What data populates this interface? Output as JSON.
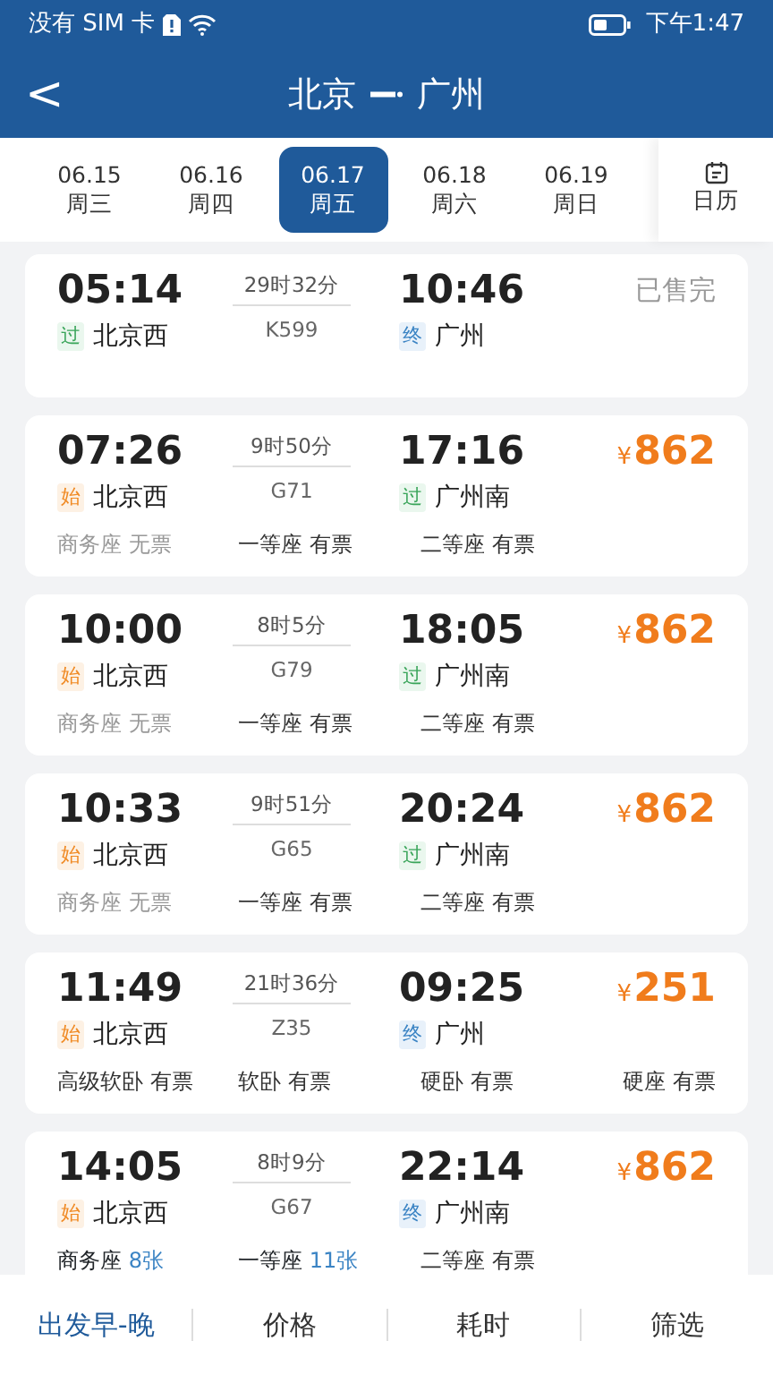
{
  "status_bar": {
    "carrier": "没有 SIM 卡",
    "time": "下午1:47"
  },
  "header": {
    "back": "<",
    "from": "北京",
    "to": "广州"
  },
  "dates": [
    {
      "date": "06.15",
      "weekday": "周三",
      "selected": false
    },
    {
      "date": "06.16",
      "weekday": "周四",
      "selected": false
    },
    {
      "date": "06.17",
      "weekday": "周五",
      "selected": true
    },
    {
      "date": "06.18",
      "weekday": "周六",
      "selected": false
    },
    {
      "date": "06.19",
      "weekday": "周日",
      "selected": false
    }
  ],
  "calendar": {
    "label": "日历"
  },
  "trains": [
    {
      "depart_time": "05:14",
      "depart_tag": {
        "kind": "pass",
        "text": "过"
      },
      "depart_station": "北京西",
      "duration": "29时32分",
      "number": "K599",
      "arrive_time": "10:46",
      "arrive_tag": {
        "kind": "end",
        "text": "终"
      },
      "arrive_station": "广州",
      "fare": {
        "kind": "sold_out",
        "text": "已售完"
      }
    },
    {
      "depart_time": "07:26",
      "depart_tag": {
        "kind": "start",
        "text": "始"
      },
      "depart_station": "北京西",
      "duration": "9时50分",
      "number": "G71",
      "arrive_time": "17:16",
      "arrive_tag": {
        "kind": "pass",
        "text": "过"
      },
      "arrive_station": "广州南",
      "fare": {
        "kind": "price",
        "currency": "¥",
        "text": "862"
      },
      "seats": [
        {
          "name": "商务座",
          "status": "无票",
          "kind": "none"
        },
        {
          "name": "一等座",
          "status": "有票",
          "kind": "available"
        },
        {
          "name": "二等座",
          "status": "有票",
          "kind": "available"
        }
      ]
    },
    {
      "depart_time": "10:00",
      "depart_tag": {
        "kind": "start",
        "text": "始"
      },
      "depart_station": "北京西",
      "duration": "8时5分",
      "number": "G79",
      "arrive_time": "18:05",
      "arrive_tag": {
        "kind": "pass",
        "text": "过"
      },
      "arrive_station": "广州南",
      "fare": {
        "kind": "price",
        "currency": "¥",
        "text": "862"
      },
      "seats": [
        {
          "name": "商务座",
          "status": "无票",
          "kind": "none"
        },
        {
          "name": "一等座",
          "status": "有票",
          "kind": "available"
        },
        {
          "name": "二等座",
          "status": "有票",
          "kind": "available"
        }
      ]
    },
    {
      "depart_time": "10:33",
      "depart_tag": {
        "kind": "start",
        "text": "始"
      },
      "depart_station": "北京西",
      "duration": "9时51分",
      "number": "G65",
      "arrive_time": "20:24",
      "arrive_tag": {
        "kind": "pass",
        "text": "过"
      },
      "arrive_station": "广州南",
      "fare": {
        "kind": "price",
        "currency": "¥",
        "text": "862"
      },
      "seats": [
        {
          "name": "商务座",
          "status": "无票",
          "kind": "none"
        },
        {
          "name": "一等座",
          "status": "有票",
          "kind": "available"
        },
        {
          "name": "二等座",
          "status": "有票",
          "kind": "available"
        }
      ]
    },
    {
      "depart_time": "11:49",
      "depart_tag": {
        "kind": "start",
        "text": "始"
      },
      "depart_station": "北京西",
      "duration": "21时36分",
      "number": "Z35",
      "arrive_time": "09:25",
      "arrive_tag": {
        "kind": "end",
        "text": "终"
      },
      "arrive_station": "广州",
      "fare": {
        "kind": "price",
        "currency": "¥",
        "text": "251"
      },
      "seats": [
        {
          "name": "高级软卧",
          "status": "有票",
          "kind": "available"
        },
        {
          "name": "软卧",
          "status": "有票",
          "kind": "available"
        },
        {
          "name": "硬卧",
          "status": "有票",
          "kind": "available"
        },
        {
          "name": "硬座",
          "status": "有票",
          "kind": "available"
        }
      ]
    },
    {
      "depart_time": "14:05",
      "depart_tag": {
        "kind": "start",
        "text": "始"
      },
      "depart_station": "北京西",
      "duration": "8时9分",
      "number": "G67",
      "arrive_time": "22:14",
      "arrive_tag": {
        "kind": "end",
        "text": "终"
      },
      "arrive_station": "广州南",
      "fare": {
        "kind": "price",
        "currency": "¥",
        "text": "862"
      },
      "seats": [
        {
          "name": "商务座",
          "status": "8张",
          "kind": "count"
        },
        {
          "name": "一等座",
          "status": "11张",
          "kind": "count"
        },
        {
          "name": "二等座",
          "status": "有票",
          "kind": "available"
        }
      ]
    }
  ],
  "sort_bar": [
    {
      "label": "出发早-晚",
      "selected": true
    },
    {
      "label": "价格",
      "selected": false
    },
    {
      "label": "耗时",
      "selected": false
    },
    {
      "label": "筛选",
      "selected": false
    }
  ]
}
